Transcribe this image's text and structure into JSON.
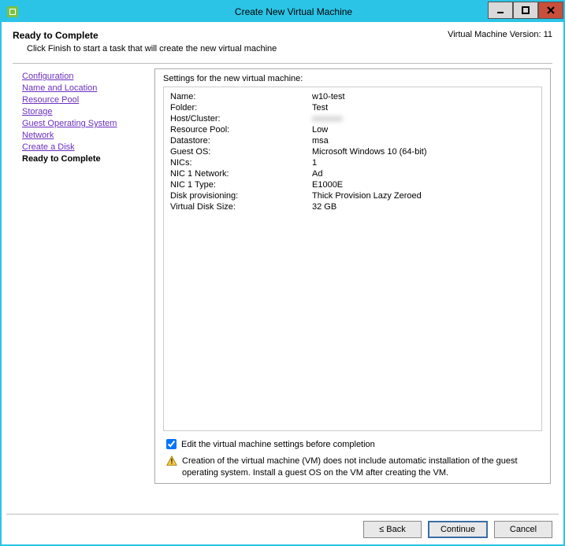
{
  "window": {
    "title": "Create New Virtual Machine"
  },
  "header": {
    "pageTitle": "Ready to Complete",
    "subtitle": "Click Finish to start a task that will create the new virtual machine",
    "versionLabel": "Virtual Machine Version: 11"
  },
  "sidebar": {
    "items": [
      "Configuration",
      "Name and Location",
      "Resource Pool",
      "Storage",
      "Guest Operating System",
      "Network",
      "Create a Disk"
    ],
    "current": "Ready to Complete"
  },
  "panel": {
    "heading": "Settings for the new virtual machine:",
    "rows": [
      {
        "label": "Name:",
        "value": "w10-test",
        "blur": false
      },
      {
        "label": "Folder:",
        "value": "Test",
        "blur": false
      },
      {
        "label": "Host/Cluster:",
        "value": "xxxxxxx",
        "blur": true
      },
      {
        "label": "Resource Pool:",
        "value": "Low",
        "blur": false
      },
      {
        "label": "Datastore:",
        "value": "msa",
        "blur": false
      },
      {
        "label": "Guest OS:",
        "value": "Microsoft Windows 10 (64-bit)",
        "blur": false
      },
      {
        "label": "NICs:",
        "value": "1",
        "blur": false
      },
      {
        "label": "NIC 1 Network:",
        "value": "Ad",
        "blur": false
      },
      {
        "label": "NIC 1 Type:",
        "value": "E1000E",
        "blur": false
      },
      {
        "label": "Disk provisioning:",
        "value": "Thick Provision Lazy Zeroed",
        "blur": false
      },
      {
        "label": "Virtual Disk Size:",
        "value": "32 GB",
        "blur": false
      }
    ],
    "checkboxLabel": "Edit the virtual machine settings before completion",
    "checkboxChecked": true,
    "warningText": "Creation of the virtual machine (VM) does not include automatic installation of the guest operating system. Install a guest OS on the VM after creating the VM."
  },
  "footer": {
    "back": "≤ Back",
    "continue": "Continue",
    "cancel": "Cancel"
  }
}
